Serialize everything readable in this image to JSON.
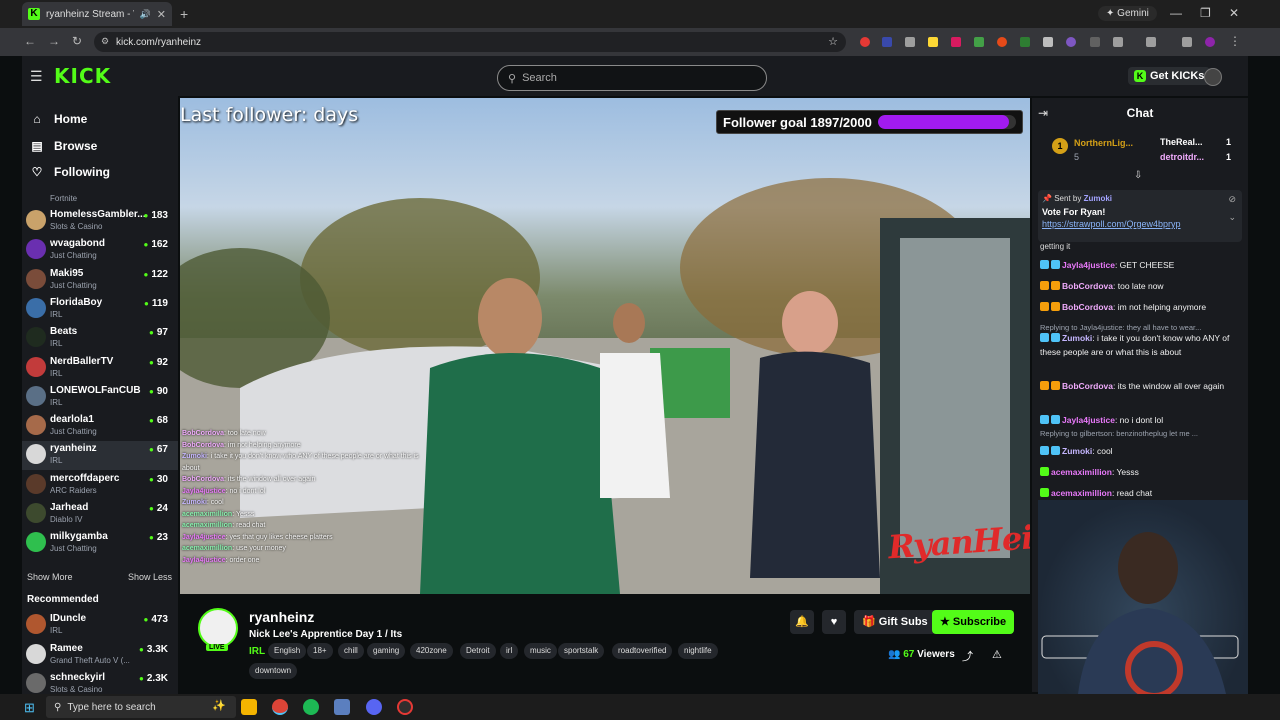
{
  "browser": {
    "tab_title": "ryanheinz Stream - Watch L",
    "tab_icon": "kick-favicon",
    "url": "kick.com/ryanheinz",
    "gemini_label": "Gemini"
  },
  "header": {
    "logo": "KICK",
    "search_placeholder": "Search",
    "get_kicks_label": "Get KICKs"
  },
  "sidebar": {
    "nav": [
      {
        "label": "Home",
        "icon": "home-icon"
      },
      {
        "label": "Browse",
        "icon": "browse-icon"
      },
      {
        "label": "Following",
        "icon": "heart-icon"
      }
    ],
    "partial_category": "Fortnite",
    "following": [
      {
        "name": "HomelessGambler...",
        "category": "Slots & Casino",
        "viewers": "183",
        "color": "#c9a26a"
      },
      {
        "name": "wvagabond",
        "category": "Just Chatting",
        "viewers": "162",
        "color": "#6a2fb0"
      },
      {
        "name": "Maki95",
        "category": "Just Chatting",
        "viewers": "122",
        "color": "#7a4c3a"
      },
      {
        "name": "FloridaBoy",
        "category": "IRL",
        "viewers": "119",
        "color": "#3a6ea8"
      },
      {
        "name": "Beats",
        "category": "IRL",
        "viewers": "97",
        "color": "#1f2b1f"
      },
      {
        "name": "NerdBallerTV",
        "category": "IRL",
        "viewers": "92",
        "color": "#c23b3b"
      },
      {
        "name": "LONEWOLFanCUB",
        "category": "IRL",
        "viewers": "90",
        "color": "#5a6f86"
      },
      {
        "name": "dearlola1",
        "category": "Just Chatting",
        "viewers": "68",
        "color": "#a66a4a"
      },
      {
        "name": "ryanheinz",
        "category": "IRL",
        "viewers": "67",
        "color": "#d8d8d8"
      },
      {
        "name": "mercoffdaperc",
        "category": "ARC Raiders",
        "viewers": "30",
        "color": "#5a3a2a"
      },
      {
        "name": "Jarhead",
        "category": "Diablo IV",
        "viewers": "24",
        "color": "#3d4a2e"
      },
      {
        "name": "milkygamba",
        "category": "Just Chatting",
        "viewers": "23",
        "color": "#2fbf4e"
      }
    ],
    "show_more": "Show More",
    "show_less": "Show Less",
    "recommended_heading": "Recommended",
    "recommended": [
      {
        "name": "IDuncle",
        "category": "IRL",
        "viewers": "473",
        "color": "#b0572f"
      },
      {
        "name": "Ramee",
        "category": "Grand Theft Auto V (...",
        "viewers": "3.3K",
        "color": "#d8d8d8"
      },
      {
        "name": "schneckyirl",
        "category": "Slots & Casino",
        "viewers": "2.3K",
        "color": "#6a6a6a"
      }
    ]
  },
  "video": {
    "last_follower": "Last follower: days",
    "follower_goal_label": "Follower goal 1897/2000",
    "follower_goal_fraction": 0.9485,
    "goal_color": "#a21bf0",
    "watermark": "RyanHeinz",
    "overlay_chat": [
      {
        "user": "BobCordova",
        "text": "too late now"
      },
      {
        "user": "BobCordova",
        "text": "im not helping anymore"
      },
      {
        "user": "Zumoki",
        "text": "i take it you don't know who ANY of these people are or what this is about"
      },
      {
        "user": "BobCordova",
        "text": "its the window all over again"
      },
      {
        "user": "Jayla4justice",
        "text": "no i dont lol"
      },
      {
        "user": "Zumoki",
        "text": "cool"
      },
      {
        "user": "acemaximillion",
        "text": "Yesss"
      },
      {
        "user": "acemaximillion",
        "text": "read chat"
      },
      {
        "user": "Jayla4justice",
        "text": "yes that guy likes cheese platters"
      },
      {
        "user": "acemaximillion",
        "text": "use your money"
      },
      {
        "user": "Jayla4justice",
        "text": "order one"
      }
    ]
  },
  "stream": {
    "name": "ryanheinz",
    "live_label": "LIVE",
    "title": "Nick Lee's Apprentice Day 1 / Its",
    "category": "IRL",
    "tags": [
      "English",
      "18+",
      "chill",
      "gaming",
      "420zone",
      "Detroit",
      "irl",
      "music",
      "sportstalk",
      "roadtoverified",
      "nightlife",
      "downtown"
    ],
    "gift_subs_label": "Gift Subs",
    "subscribe_label": "Subscribe",
    "viewers_count": "67",
    "viewers_label": "Viewers"
  },
  "chat": {
    "title": "Chat",
    "leaders": [
      {
        "rank": "1",
        "name": "NorthernLig...",
        "sub": "5"
      },
      {
        "name": "TheReal...",
        "count": "1"
      },
      {
        "name": "detroitdr...",
        "count": "1"
      }
    ],
    "pinned": {
      "sent_by_label": "Sent by",
      "sent_by_user": "Zumoki",
      "text": "Vote For Ryan!",
      "link": "https://strawpoll.com/Qrgew4bpryp",
      "truncated": "getting it"
    },
    "messages": [
      {
        "user": "Jayla4justice",
        "text": "GET CHEESE",
        "color": "#e879f9"
      },
      {
        "user": "BobCordova",
        "text": "too late now",
        "color": "#f0abfc"
      },
      {
        "user": "BobCordova",
        "text": "im not helping anymore",
        "color": "#f0abfc"
      },
      {
        "reply": "Replying to Jayla4justice: they all have to wear..."
      },
      {
        "user": "Zumoki",
        "text": "i take it you don't know who ANY of these people are or what this is about",
        "color": "#c4b5fd"
      },
      {
        "user": "BobCordova",
        "text": "its the window all over again",
        "color": "#f0abfc"
      },
      {
        "user": "Jayla4justice",
        "text": "no i dont lol",
        "color": "#e879f9"
      },
      {
        "reply": "Replying to gilbertson: benzinotheplug let me ..."
      },
      {
        "user": "Zumoki",
        "text": "cool",
        "color": "#c4b5fd"
      },
      {
        "user": "acemaximillion",
        "text": "Yesss",
        "color": "#e879f9"
      },
      {
        "user": "acemaximillion",
        "text": "read chat",
        "color": "#e879f9"
      },
      {
        "user": "Jayla4justice",
        "text": "yes that guy likes cheese platters",
        "color": "#e879f9"
      },
      {
        "user": "acemaximillion",
        "text": "",
        "color": "#e879f9"
      },
      {
        "user": "Jayla4justice",
        "text": "",
        "color": "#e879f9"
      }
    ]
  },
  "taskbar": {
    "search_placeholder": "Type here to search"
  }
}
